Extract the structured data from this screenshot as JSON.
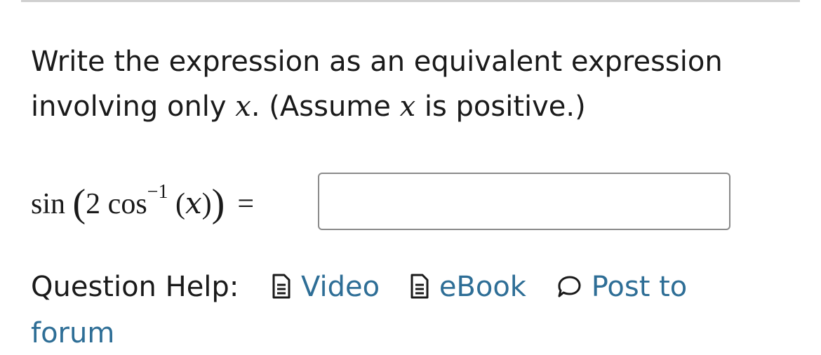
{
  "question": {
    "prompt_part1": "Write the expression as an equivalent expression involving only ",
    "var": "x",
    "prompt_part2": ". (Assume ",
    "var2": "x",
    "prompt_part3": " is positive.)"
  },
  "equation": {
    "fn": "sin",
    "open_outer": "(",
    "coef": "2",
    "fn2": "cos",
    "exponent": "−1",
    "open_inner": "(",
    "var": "x",
    "close_inner": ")",
    "close_outer": ")",
    "equals": "=",
    "answer_value": "",
    "answer_placeholder": ""
  },
  "help": {
    "label": "Question Help:",
    "links": [
      {
        "label": "Video",
        "icon": "document-icon"
      },
      {
        "label": "eBook",
        "icon": "document-icon"
      },
      {
        "label": "Post to forum",
        "icon": "speech-bubble-icon"
      }
    ]
  },
  "colors": {
    "link": "#2e6e96",
    "text": "#1a1a1a",
    "input_border": "#8a8a8a",
    "rule": "#d0d0d0"
  }
}
